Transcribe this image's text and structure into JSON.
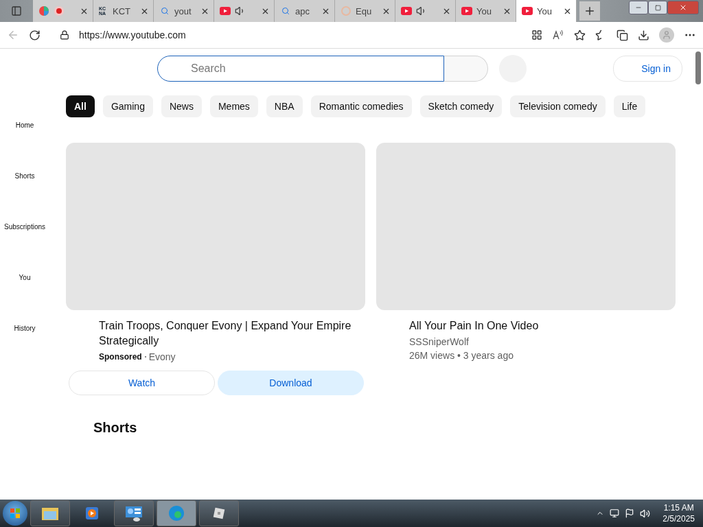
{
  "tabs": [
    {
      "kind": "pinwheel",
      "recording": true,
      "audio": false,
      "selected": false
    },
    {
      "kind": "letters",
      "favicon_text": "KC NA",
      "title": "KCT",
      "recording": false,
      "audio": false,
      "selected": false
    },
    {
      "kind": "search",
      "title": "yout",
      "recording": false,
      "audio": false,
      "selected": false
    },
    {
      "kind": "youtube",
      "recording": false,
      "audio": true,
      "selected": false
    },
    {
      "kind": "search",
      "title": "apc",
      "recording": false,
      "audio": false,
      "selected": false
    },
    {
      "kind": "faded",
      "title": "Equ",
      "recording": false,
      "audio": false,
      "selected": false
    },
    {
      "kind": "youtube",
      "recording": false,
      "audio": true,
      "selected": false
    },
    {
      "kind": "youtube",
      "title": "You",
      "recording": false,
      "audio": false,
      "selected": false
    },
    {
      "kind": "youtube",
      "title": "You",
      "recording": false,
      "audio": false,
      "selected": true
    }
  ],
  "address_bar": {
    "url": "https://www.youtube.com"
  },
  "masthead": {
    "search_placeholder": "Search",
    "sign_in": "Sign in"
  },
  "sidebar": {
    "items": [
      {
        "label": "Home"
      },
      {
        "label": "Shorts"
      },
      {
        "label": "Subscriptions"
      },
      {
        "label": "You"
      },
      {
        "label": "History"
      }
    ]
  },
  "chips": [
    {
      "label": "All",
      "selected": true
    },
    {
      "label": "Gaming",
      "selected": false
    },
    {
      "label": "News",
      "selected": false
    },
    {
      "label": "Memes",
      "selected": false
    },
    {
      "label": "NBA",
      "selected": false
    },
    {
      "label": "Romantic comedies",
      "selected": false
    },
    {
      "label": "Sketch comedy",
      "selected": false
    },
    {
      "label": "Television comedy",
      "selected": false
    },
    {
      "label": "Life",
      "selected": false
    }
  ],
  "videos": [
    {
      "kind": "ad",
      "title": "Train Troops, Conquer Evony | Expand Your Empire Strategically",
      "badge": "Sponsored",
      "advertiser": "Evony",
      "buttons": [
        {
          "label": "Watch",
          "primary": false
        },
        {
          "label": "Download",
          "primary": true
        }
      ]
    },
    {
      "kind": "video",
      "title": "All Your Pain In One Video",
      "channel": "SSSniperWolf",
      "meta": "26M views • 3 years ago"
    }
  ],
  "shelf": {
    "title": "Shorts"
  },
  "taskbar": {
    "time": "1:15 AM",
    "date": "2/5/2025"
  }
}
